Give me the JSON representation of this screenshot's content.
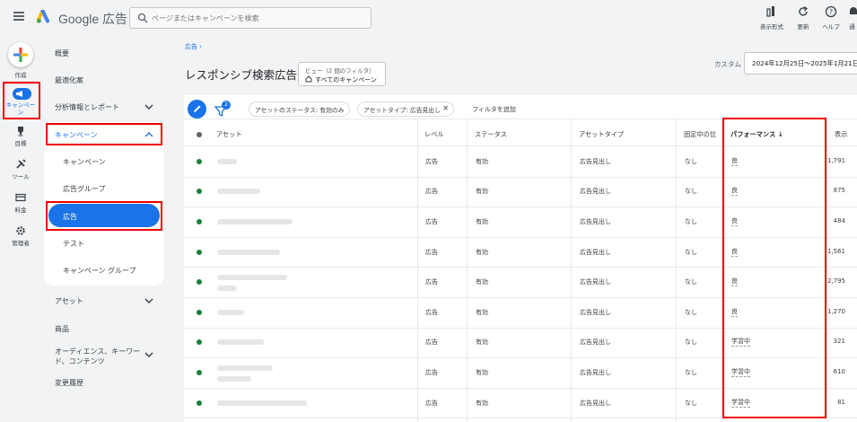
{
  "app": {
    "name": "Google 広告",
    "search_placeholder": "ページまたはキャンペーンを検索"
  },
  "toolbar": {
    "items": [
      {
        "label": "表示形式",
        "icon": "bar-chart-icon"
      },
      {
        "label": "更新",
        "icon": "refresh-icon"
      },
      {
        "label": "ヘルプ",
        "icon": "help-icon"
      },
      {
        "label": "通",
        "icon": "bell-icon"
      }
    ]
  },
  "rail": {
    "create": "作成",
    "campaigns": "キャンペーン",
    "goals": "目標",
    "tools": "ツール",
    "billing": "料金",
    "admin": "管理者"
  },
  "nav": {
    "overview": "概要",
    "recommendations": "最適化案",
    "insights": "分析情報とレポート",
    "campaigns_section": "キャンペーン",
    "sub": [
      "キャンペーン",
      "広告グループ",
      "広告",
      "テスト",
      "キャンペーン グループ"
    ],
    "assets": "アセット",
    "products": "商品",
    "audiences": "オーディエンス、キーワード、コンテンツ",
    "change_history": "変更履歴"
  },
  "header": {
    "breadcrumb": "広告 ›",
    "title": "レスポンシブ検索広告",
    "view_label": "ビュー（2 個のフィルタ）",
    "view_value": "すべてのキャンペーン",
    "custom_label": "カスタム",
    "date_range": "2024年12月25日～2025年1月21日"
  },
  "filters": {
    "badge": "2",
    "chips": [
      "アセットのステータス: 有効のみ",
      "アセットタイプ: 広告見出し"
    ],
    "add_filter": "フィルタを追加"
  },
  "table": {
    "columns": [
      "アセット",
      "レベル",
      "ステータス",
      "アセットタイプ",
      "固定中の位",
      "パフォーマンス",
      "表示"
    ],
    "sort_indicator": "↓",
    "rows": [
      {
        "level": "広告",
        "status": "有効",
        "type": "広告見出し",
        "pinned": "なし",
        "performance": "良",
        "impressions": "1,791"
      },
      {
        "level": "広告",
        "status": "有効",
        "type": "広告見出し",
        "pinned": "なし",
        "performance": "良",
        "impressions": "875"
      },
      {
        "level": "広告",
        "status": "有効",
        "type": "広告見出し",
        "pinned": "なし",
        "performance": "良",
        "impressions": "484"
      },
      {
        "level": "広告",
        "status": "有効",
        "type": "広告見出し",
        "pinned": "なし",
        "performance": "良",
        "impressions": "1,561"
      },
      {
        "level": "広告",
        "status": "有効",
        "type": "広告見出し",
        "pinned": "なし",
        "performance": "良",
        "impressions": "2,795"
      },
      {
        "level": "広告",
        "status": "有効",
        "type": "広告見出し",
        "pinned": "なし",
        "performance": "良",
        "impressions": "1,270"
      },
      {
        "level": "広告",
        "status": "有効",
        "type": "広告見出し",
        "pinned": "なし",
        "performance": "学習中",
        "impressions": "321"
      },
      {
        "level": "広告",
        "status": "有効",
        "type": "広告見出し",
        "pinned": "なし",
        "performance": "学習中",
        "impressions": "610"
      },
      {
        "level": "広告",
        "status": "有効",
        "type": "広告見出し",
        "pinned": "なし",
        "performance": "学習中",
        "impressions": "81"
      }
    ]
  },
  "colors": {
    "accent": "#1a73e8",
    "highlight": "#e00000",
    "status_enabled": "#188038"
  }
}
